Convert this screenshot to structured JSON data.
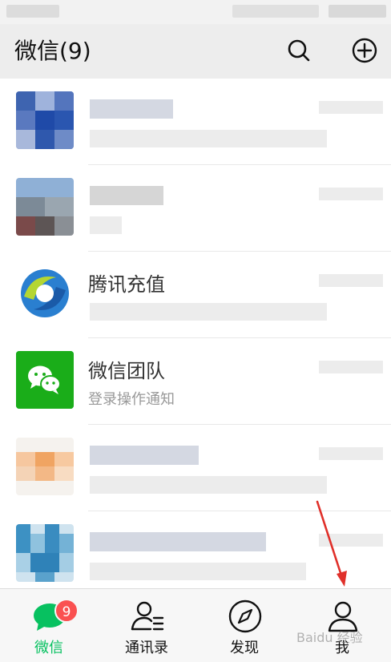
{
  "header": {
    "title": "微信(9)"
  },
  "chats": [
    {
      "name": "",
      "preview": "",
      "avatar": "blurred-blue"
    },
    {
      "name": "",
      "preview": "",
      "avatar": "blurred-photo"
    },
    {
      "name": "腾讯充值",
      "preview": "",
      "avatar": "tencent-recharge-logo"
    },
    {
      "name": "微信团队",
      "preview": "登录操作通知",
      "avatar": "wechat-team-logo"
    },
    {
      "name": "",
      "preview": "",
      "avatar": "blurred-orange"
    },
    {
      "name": "",
      "preview": "",
      "avatar": "blurred-w"
    }
  ],
  "tabbar": {
    "tabs": [
      {
        "label": "微信",
        "badge": "9",
        "icon": "chat-bubble-icon",
        "active": true
      },
      {
        "label": "通讯录",
        "icon": "contacts-icon"
      },
      {
        "label": "发现",
        "icon": "compass-icon"
      },
      {
        "label": "我",
        "icon": "person-icon"
      }
    ]
  },
  "watermark": "Baidu 经验",
  "colors": {
    "accent": "#07c160",
    "badge": "#fa5151",
    "header_bg": "#ededed",
    "arrow": "#e0302a"
  }
}
